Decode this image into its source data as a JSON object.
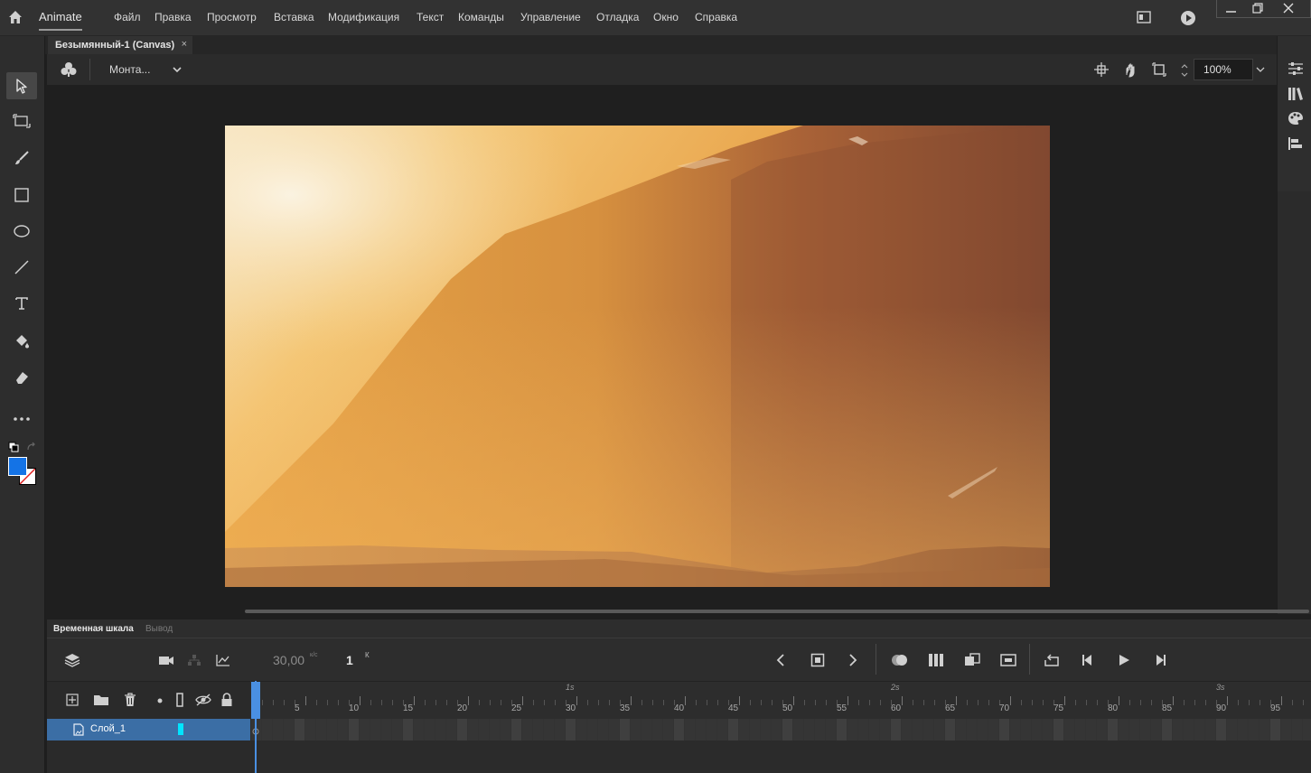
{
  "app": {
    "name": "Animate"
  },
  "menu": [
    "Файл",
    "Правка",
    "Просмотр",
    "Вставка",
    "Модификация",
    "Текст",
    "Команды",
    "Управление",
    "Отладка",
    "Окно",
    "Справка"
  ],
  "document_tab": {
    "title": "Безымянный-1 (Canvas)",
    "close": "×"
  },
  "editbar": {
    "scene_label": "Монта...",
    "zoom": "100%"
  },
  "timeline": {
    "tabs": [
      "Временная шкала",
      "Вывод"
    ],
    "fps": "30,00",
    "fps_unit": "к/с",
    "current_frame": "1",
    "frame_unit": "К",
    "ruler_ticks": [
      "5",
      "10",
      "15",
      "20",
      "25",
      "30",
      "35",
      "40",
      "45",
      "50",
      "55",
      "60",
      "65",
      "70",
      "75",
      "80",
      "85",
      "90",
      "95"
    ],
    "seconds": [
      "1s",
      "2s",
      "3s"
    ],
    "layer_name": "Слой_1"
  },
  "colors": {
    "accent": "#3b6ea5",
    "stroke_swatch": "#ffffff",
    "fill_swatch": "#1473e6",
    "playhead": "#4a90e2"
  }
}
